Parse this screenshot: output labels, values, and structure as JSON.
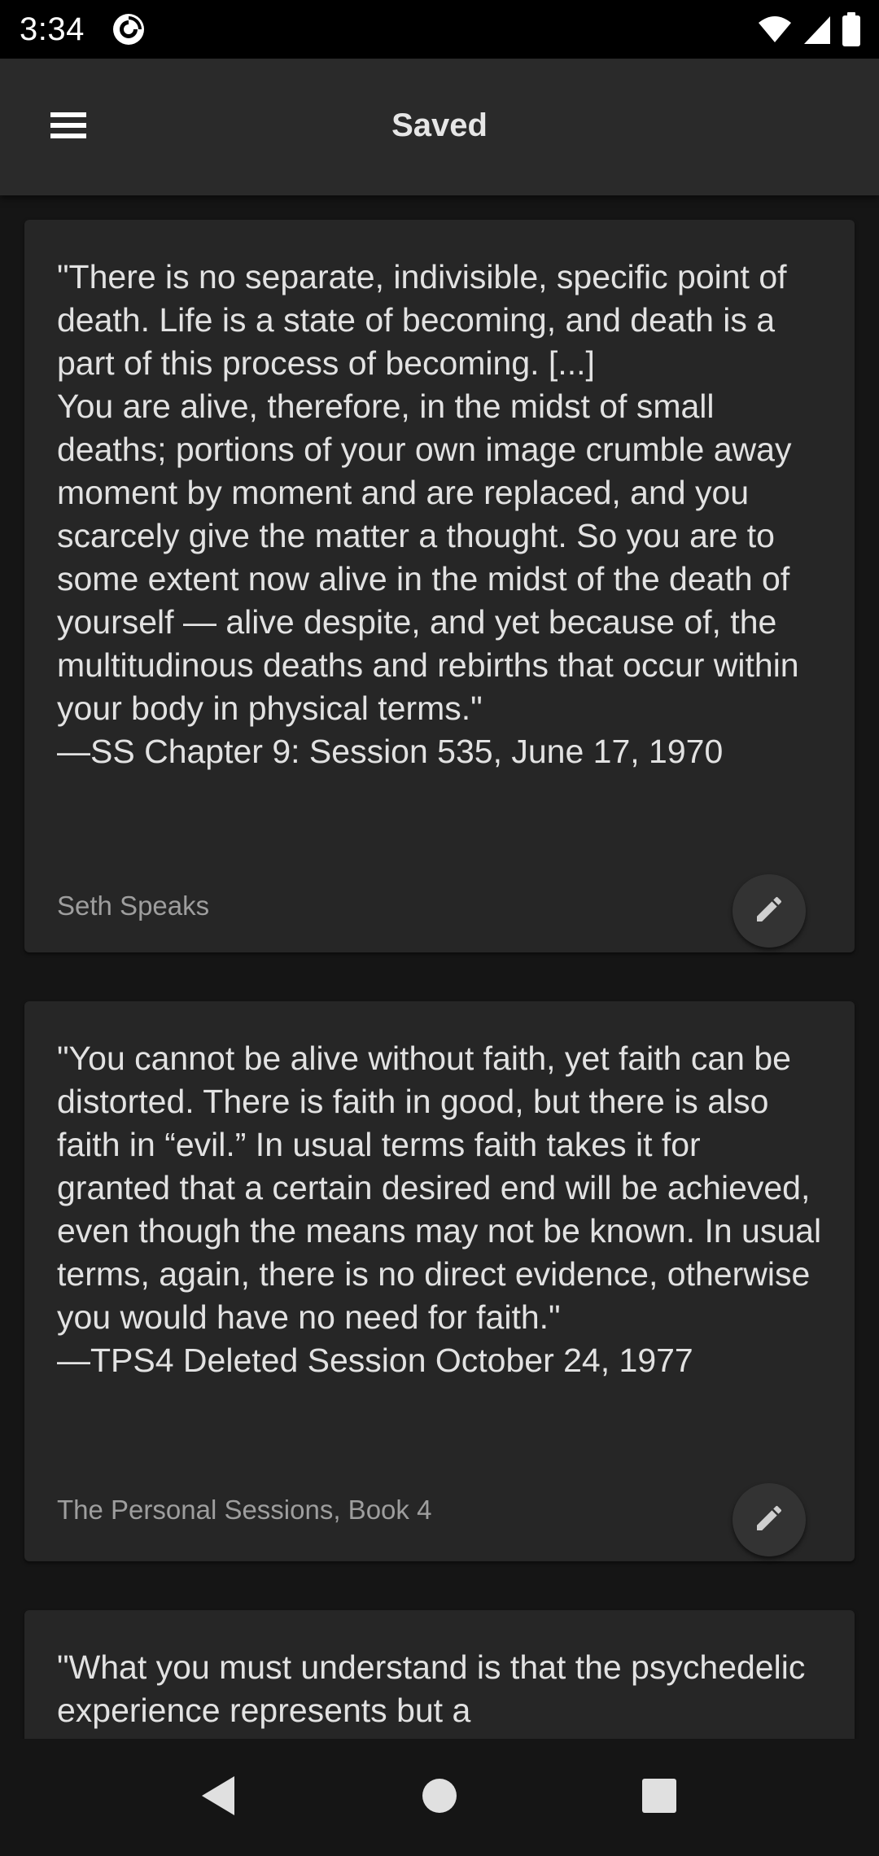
{
  "status_bar": {
    "time": "3:34",
    "app_icon": "pocket-casts-icon",
    "wifi_icon": "wifi-icon",
    "signal_icon": "signal-icon",
    "battery_icon": "battery-icon"
  },
  "app_bar": {
    "title": "Saved",
    "menu_icon": "hamburger-menu-icon"
  },
  "cards": [
    {
      "quote": "\"There is no separate, indivisible, specific point of death. Life is a state of becoming, and death is a part of this process of becoming. [...]\nYou are alive, therefore, in the midst of small deaths; portions of your own image crumble away moment by moment and are replaced, and you scarcely give the matter a thought. So you are to some extent now alive in the midst of the death of yourself — alive despite, and yet because of, the multitudinous deaths and rebirths that occur within your body in physical terms.\"\n—SS Chapter 9: Session 535, June 17, 1970",
      "source": "Seth Speaks"
    },
    {
      "quote": "\"You cannot be alive without faith, yet faith can be distorted. There is faith in good, but there is also faith in “evil.” In usual terms faith takes it for granted that a certain desired end will be achieved, even though the means may not be known. In usual terms, again, there is no direct evidence, otherwise you would have no need for faith.\"\n—TPS4 Deleted Session October 24, 1977",
      "source": "The Personal Sessions, Book 4"
    },
    {
      "quote": "\"What you must understand is that the psychedelic experience represents but a",
      "source": ""
    }
  ],
  "nav_bar": {
    "back_icon": "back-triangle-icon",
    "home_icon": "home-circle-icon",
    "recents_icon": "recents-square-icon"
  },
  "colors": {
    "background": "#151515",
    "app_bar": "#2a2a2a",
    "card": "#262626",
    "text": "#e2e2e2",
    "secondary_text": "#9e9e9e"
  }
}
